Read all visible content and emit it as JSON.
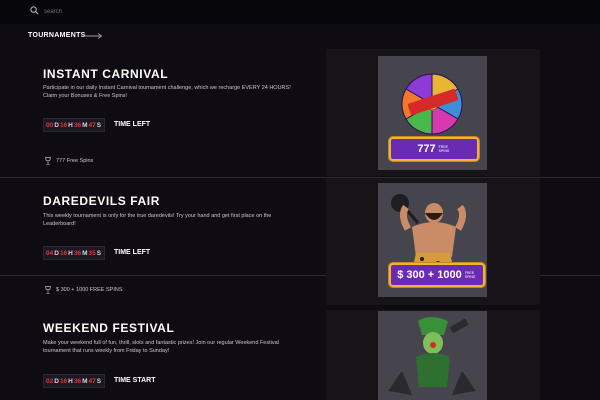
{
  "search": {
    "placeholder": "search"
  },
  "section": {
    "title": "TOURNAMENTS"
  },
  "tournaments": [
    {
      "title": "INSTANT CARNIVAL",
      "description": "Participate in our daily Instant Carnival tournament challenge, which we recharge EVERY 24 HOURS! Claim your Bonuses & Free Spins!",
      "timer": {
        "d": "00",
        "h": "16",
        "m": "36",
        "s": "47"
      },
      "timer_label": "TIME LEFT",
      "prize": "777 Free Spins",
      "badge": {
        "amount": "777",
        "sub": "FREE SPINS"
      }
    },
    {
      "title": "DAREDEVILS FAIR",
      "description": "This weekly tournament is only for the true daredevils! Try your hand and get first place on the Leaderboard!",
      "timer": {
        "d": "04",
        "h": "16",
        "m": "36",
        "s": "35"
      },
      "timer_label": "TIME LEFT",
      "prize": "$ 300 + 1000 FREE SPINS",
      "badge": {
        "amount": "$ 300 + 1000",
        "sub": "FREE SPINS"
      }
    },
    {
      "title": "WEEKEND FESTIVAL",
      "description": "Make your weekend full of fun, thrill, slots and fantastic prizes! Join our regular Weekend Festival tournament that runs weekly from Friday to Sunday!",
      "timer": {
        "d": "02",
        "h": "16",
        "m": "36",
        "s": "47"
      },
      "timer_label": "TIME START",
      "prize": "",
      "badge": {
        "amount": "",
        "sub": ""
      }
    }
  ],
  "units": {
    "d": "D",
    "h": "H",
    "m": "M",
    "s": "S"
  },
  "colors": {
    "background": "#0e0c12",
    "timer_digits": "#e53a3a",
    "badge_purple": "#6a2bb4",
    "badge_border": "#f2b233"
  }
}
